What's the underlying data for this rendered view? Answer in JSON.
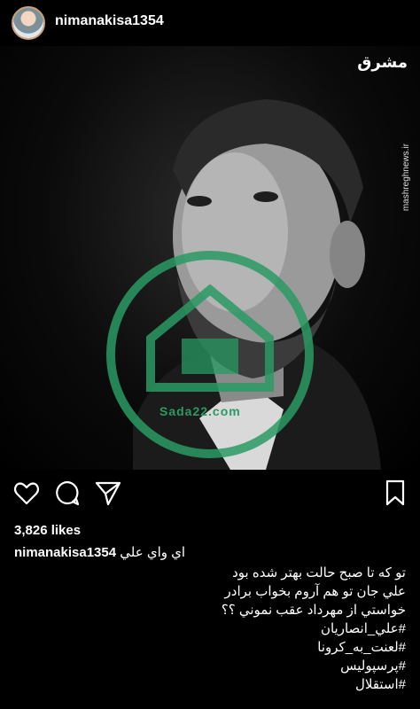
{
  "post": {
    "username": "nimanakisa1354",
    "likes": "3,826 likes",
    "caption_first": "اي واي علي",
    "caption_lines": [
      "تو که تا صبح حالت بهتر شده بود",
      "علي جان تو هم آروم بخواب برادر",
      "خواستي از مهرداد عقب نموني ؟؟",
      "#علي_انصاريان",
      "#لعنت_به_کرونا",
      "#پرسپوليس",
      "#استقلال"
    ]
  },
  "photo": {
    "logo_text": "مشرق",
    "side_url": "mashreghnews.ir",
    "watermark_text": "Sada22.com"
  },
  "icons": {
    "like": "heart-icon",
    "comment": "comment-icon",
    "share": "send-icon",
    "save": "bookmark-icon"
  },
  "colors": {
    "background": "#000000",
    "text": "#ffffff",
    "watermark": "#2a9a64"
  }
}
